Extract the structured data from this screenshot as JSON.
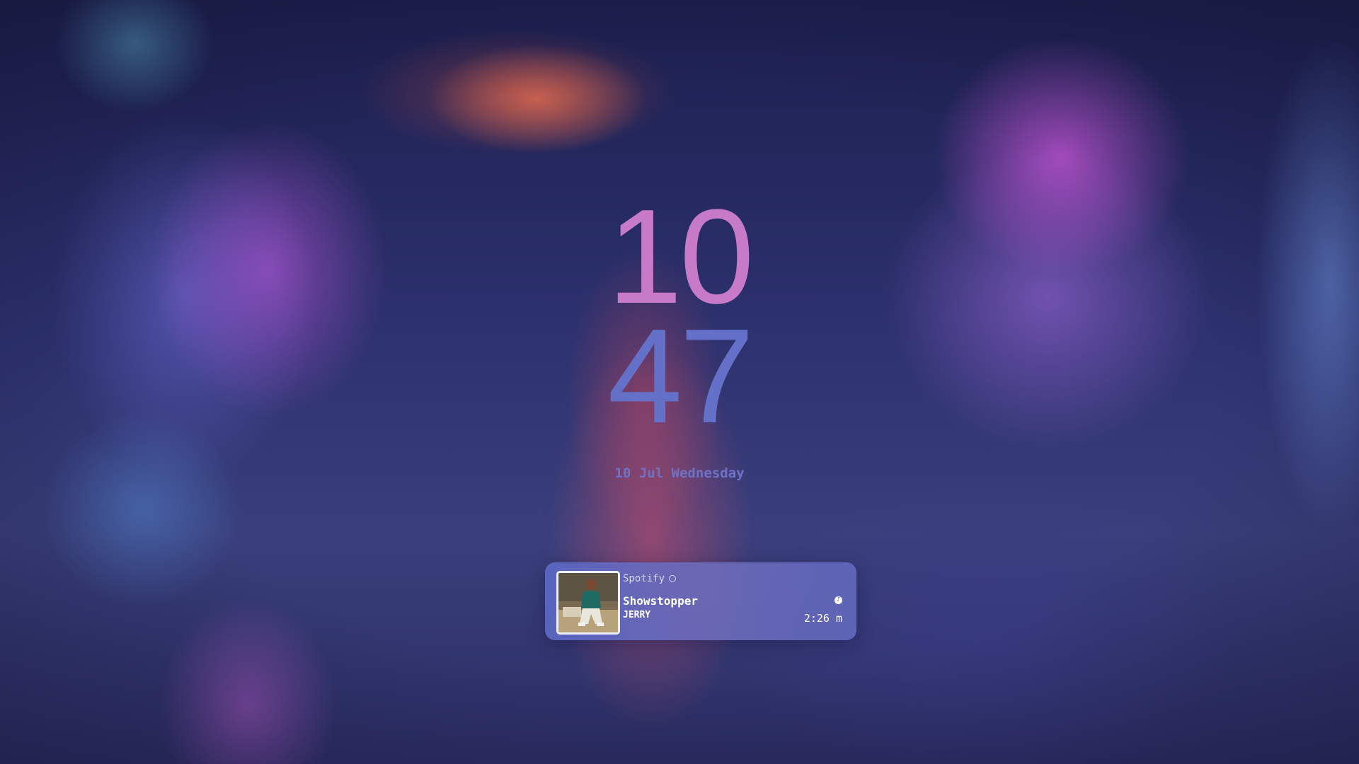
{
  "clock": {
    "hours": "10",
    "minutes": "47"
  },
  "date": {
    "label": "10 Jul Wednesday"
  },
  "media_player": {
    "app_name": "Spotify",
    "app_icon": "spotify-icon",
    "title": "Showstopper",
    "artist": "JERRY",
    "duration": "2:26 m",
    "status_icon": "music-note-icon"
  },
  "colors": {
    "hours": "#c77ac8",
    "minutes": "#6570c8",
    "date": "#6d72c6",
    "player_bg": "#5c68c4"
  }
}
